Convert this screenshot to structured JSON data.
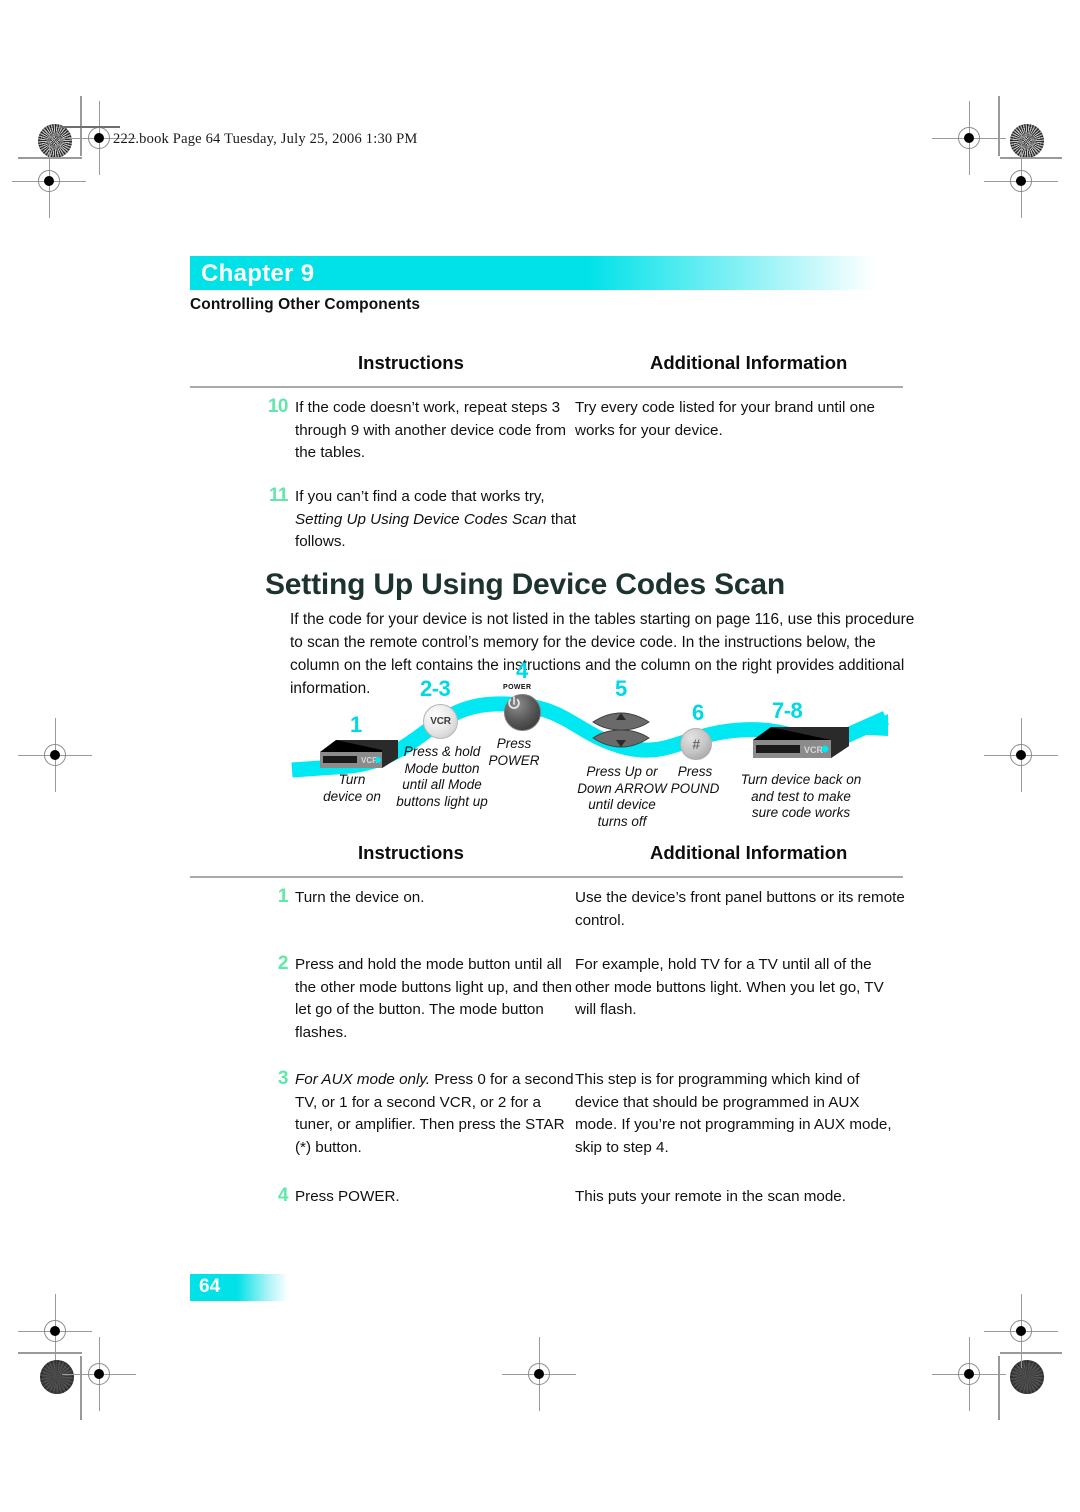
{
  "file_header": "222.book  Page 64  Tuesday, July 25, 2006  1:30 PM",
  "chapter": {
    "label": "Chapter 9",
    "subtitle": "Controlling Other Components"
  },
  "table_top": {
    "col1_header": "Instructions",
    "col2_header": "Additional Information",
    "rows": [
      {
        "num": "10",
        "instruction": "If the code doesn’t work, repeat steps 3 through 9 with another device code from the tables.",
        "additional": "Try every code listed for your brand until one works for your device."
      },
      {
        "num": "11",
        "instruction_pre": "If you can’t find a code that works try,",
        "instruction_italic": "Setting Up Using Device Codes Scan",
        "instruction_post": "that follows.",
        "additional": ""
      }
    ]
  },
  "section": {
    "heading": "Setting Up Using Device Codes Scan",
    "intro": "If the code for your device is not listed in the tables starting on page 116, use this procedure to scan the remote control’s memory for the device code. In the instructions below, the column on the left contains the instructions and the column on the right provides additional information."
  },
  "diagram": {
    "ribbon_color": "#00e8f2",
    "number_color": "#00d8e6",
    "steps": [
      {
        "num": "1",
        "caption": "Turn\ndevice on",
        "icon": "vcr-device-icon"
      },
      {
        "num": "2-3",
        "caption": "Press & hold\nMode button\nuntil all Mode\nbuttons light up",
        "icon": "vcr-mode-button-icon",
        "icon_label": "VCR"
      },
      {
        "num": "4",
        "caption": "Press\nPOWER",
        "icon": "power-button-icon",
        "icon_label": "POWER"
      },
      {
        "num": "5",
        "caption": "Press Up or\nDown ARROW\nuntil device\nturns off",
        "icon": "arrow-up-down-icon"
      },
      {
        "num": "6",
        "caption": "Press\nPOUND",
        "icon": "pound-button-icon",
        "icon_label": "#"
      },
      {
        "num": "7-8",
        "caption": "Turn device back on\nand test to make\nsure code works",
        "icon": "vcr-device-icon"
      }
    ],
    "device_label": "VCR"
  },
  "table_bottom": {
    "col1_header": "Instructions",
    "col2_header": "Additional Information",
    "rows": [
      {
        "num": "1",
        "instruction": "Turn the device on.",
        "additional": "Use the device’s front panel buttons or its remote control."
      },
      {
        "num": "2",
        "instruction": "Press and hold the mode button until all the other mode buttons light up, and then let go of the button. The mode button flashes.",
        "additional": "For example, hold TV for a TV until all of the other mode buttons light. When you let go, TV will flash."
      },
      {
        "num": "3",
        "instruction_italic": "For AUX mode only.",
        "instruction_post": "Press 0 for a second TV, or 1 for a second VCR, or 2 for a tuner, or amplifier. Then press the STAR (*) button.",
        "additional": "This step is for programming which kind of device that should be programmed in AUX mode. If you’re not programming in AUX mode, skip to step 4."
      },
      {
        "num": "4",
        "instruction": "Press POWER.",
        "additional": "This puts your remote in the scan mode."
      }
    ]
  },
  "footer": {
    "page_number": "64"
  }
}
